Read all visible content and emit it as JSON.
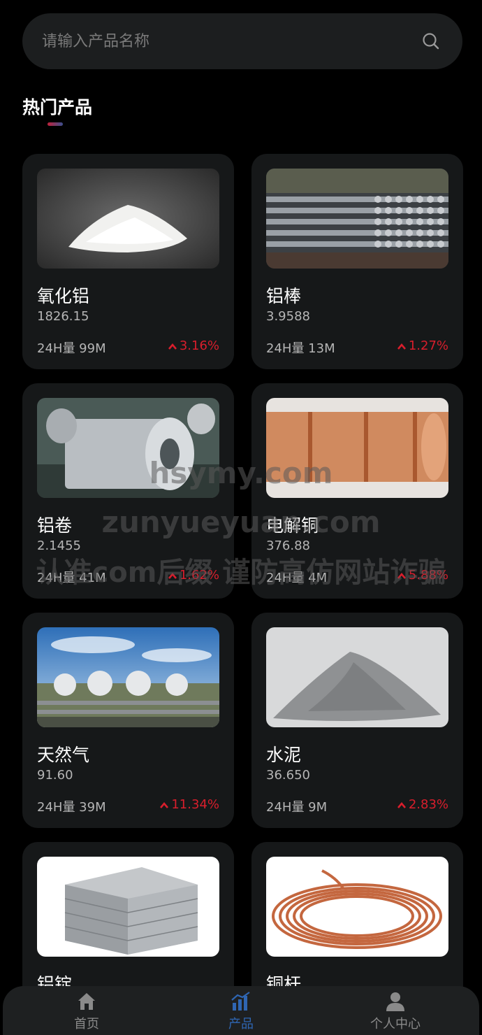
{
  "search": {
    "placeholder": "请输入产品名称",
    "icon": "search-icon"
  },
  "section": {
    "title": "热门产品"
  },
  "products": [
    {
      "name": "氧化铝",
      "price": "1826.15",
      "volume": "24H量 99M",
      "change": "3.16%",
      "image": "white-powder-image"
    },
    {
      "name": "铝棒",
      "price": "3.9588",
      "volume": "24H量 13M",
      "change": "1.27%",
      "image": "aluminum-bars-image"
    },
    {
      "name": "铝卷",
      "price": "2.1455",
      "volume": "24H量 41M",
      "change": "1.62%",
      "image": "aluminum-coil-image"
    },
    {
      "name": "电解铜",
      "price": "376.88",
      "volume": "24H量 4M",
      "change": "5.88%",
      "image": "copper-coil-image"
    },
    {
      "name": "天然气",
      "price": "91.60",
      "volume": "24H量 39M",
      "change": "11.34%",
      "image": "gas-tanks-image"
    },
    {
      "name": "水泥",
      "price": "36.650",
      "volume": "24H量 9M",
      "change": "2.83%",
      "image": "cement-pile-image"
    },
    {
      "name": "铝锭",
      "price": "",
      "volume": "",
      "change": "",
      "image": "aluminum-ingots-image"
    },
    {
      "name": "铜杆",
      "price": "",
      "volume": "",
      "change": "",
      "image": "copper-wire-image"
    }
  ],
  "watermark": {
    "line1": "hsymy.com",
    "line2": "zunyueyuan.com",
    "line3": "认准com后缀 谨防高仿网站诈骗"
  },
  "nav": [
    {
      "label": "首页",
      "icon": "home-icon",
      "active": false
    },
    {
      "label": "产品",
      "icon": "chart-icon",
      "active": true
    },
    {
      "label": "个人中心",
      "icon": "user-icon",
      "active": false
    }
  ],
  "colors": {
    "background": "#000000",
    "card": "#161819",
    "up": "#d81e2c",
    "active_nav": "#2f66b3"
  }
}
